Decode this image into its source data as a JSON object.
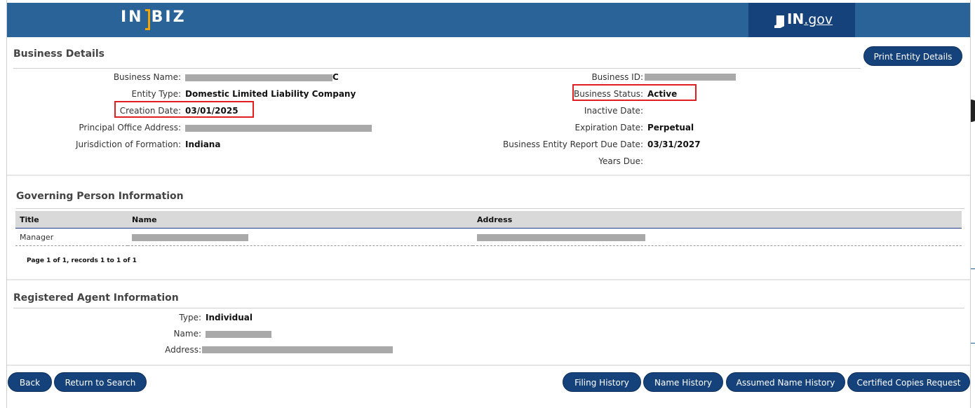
{
  "header": {
    "logo_left": "IN",
    "logo_right": "BIZ",
    "ingov_bold": "IN",
    "ingov_dot": ".gov"
  },
  "business_details": {
    "title": "Business Details",
    "print_button": "Print Entity Details",
    "left": [
      {
        "label": "Business Name:",
        "value": "C",
        "redacted": true
      },
      {
        "label": "Entity Type:",
        "value": "Domestic Limited Liability Company"
      },
      {
        "label": "Creation Date:",
        "value": "03/01/2025"
      },
      {
        "label": "Principal Office Address:",
        "value": "",
        "redacted": true
      },
      {
        "label": "Jurisdiction of Formation:",
        "value": "Indiana"
      }
    ],
    "right": [
      {
        "label": "Business ID:",
        "value": "",
        "redacted": true
      },
      {
        "label": "Business Status:",
        "value": "Active"
      },
      {
        "label": "Inactive Date:",
        "value": ""
      },
      {
        "label": "Expiration Date:",
        "value": "Perpetual"
      },
      {
        "label": "Business Entity Report Due Date:",
        "value": "03/31/2027"
      },
      {
        "label": "Years Due:",
        "value": ""
      }
    ]
  },
  "governing": {
    "title": "Governing Person Information",
    "columns": [
      "Title",
      "Name",
      "Address"
    ],
    "rows": [
      {
        "title": "Manager",
        "name": "",
        "address": ""
      }
    ],
    "pager": "Page 1 of 1, records 1 to 1 of 1"
  },
  "agent": {
    "title": "Registered Agent Information",
    "type_label": "Type:",
    "type_value": "Individual",
    "name_label": "Name:",
    "address_label": "Address:"
  },
  "footer": {
    "back": "Back",
    "return": "Return to Search",
    "filing": "Filing History",
    "name_history": "Name History",
    "assumed": "Assumed Name History",
    "certified": "Certified Copies Request"
  },
  "colors": {
    "header": "#2a6397",
    "button": "#15427a",
    "highlight": "#e02020"
  }
}
